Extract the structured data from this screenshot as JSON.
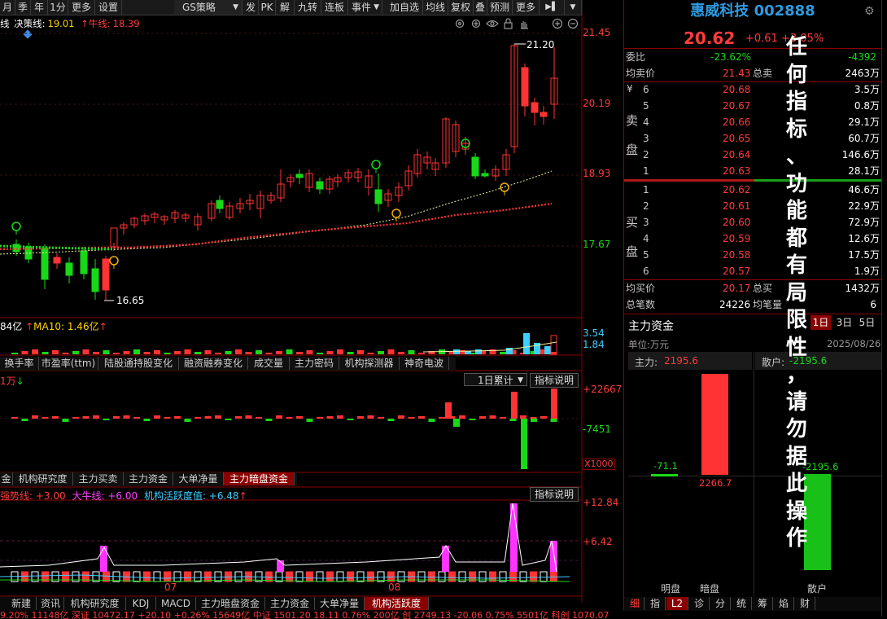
{
  "toolbar": {
    "items": [
      "月",
      "季",
      "年",
      "1分",
      "更多",
      "设置",
      "GS策略",
      "发",
      "PK",
      "解",
      "九转",
      "连板",
      "事件",
      "加自选",
      "均线",
      "复权",
      "叠",
      "预测",
      "更多"
    ],
    "strategy_dropdown_caret": "▼",
    "collapse_icon": "▶▌",
    "dropdown_caret": "▼"
  },
  "main_chart": {
    "legend": {
      "name": "线",
      "decision_label": "决策线:",
      "decision_value": "19.01",
      "bull_label": "牛线:",
      "bull_value": "18.39",
      "bull_arrow": "↑"
    },
    "price_labels": [
      "21.45",
      "20.19",
      "18.93",
      "17.67"
    ],
    "high_label": "21.20",
    "low_label": "16.65",
    "toolbar_icons": [
      "settings-icon",
      "settings-alt-icon",
      "eye-icon",
      "lock-icon",
      "hand-icon",
      "zoom-in-icon",
      "zoom-out-icon"
    ]
  },
  "volume": {
    "legend_left": "84亿",
    "ma10_label": "MA10: 1.46亿",
    "ma10_arrow": "↑",
    "labels": [
      "3.54",
      "1.84"
    ]
  },
  "tabs_1": [
    "换手率",
    "市盈率(ttm)",
    "陆股通持股变化",
    "融资融券变化",
    "成交量",
    "主力密码",
    "机构探测器",
    "神奇电波"
  ],
  "fund_flow": {
    "unit": "1万",
    "unit_arrow": "↓",
    "period_select": "1日累计",
    "explain_button": "指标说明",
    "labels": [
      "+22667",
      "-7451"
    ],
    "multiplier": "X1000"
  },
  "tabs_2": [
    "金",
    "机构研究度",
    "主力买卖",
    "主力资金",
    "大单净量",
    "主力暗盘资金"
  ],
  "indicator": {
    "legend_strong": "强势线: +3.00",
    "legend_bull": "大牛线: +6.00",
    "legend_active": "机构活跃度值: +6.48",
    "legend_active_arrow": "↑",
    "explain_button": "指标说明",
    "labels": [
      "+12.84",
      "+6.42"
    ],
    "x_labels": [
      "07",
      "08"
    ]
  },
  "tabs_bottom": [
    "新建",
    "资讯",
    "机构研究度",
    "KDJ",
    "MACD",
    "主力暗盘资金",
    "主力资金",
    "大单净量",
    "机构活跃度"
  ],
  "bottom_ticker": "9.20%   11148亿   深证   10472.17  +20.10  +0.26%   15649亿   中证   1501.20   18.11   0.76%   200亿   创   2749.13  -20.06   0.75%   5501亿   科创   1070.07",
  "stock": {
    "name": "惠威科技",
    "code": "002888",
    "price": "20.62",
    "change": "+0.61",
    "change_pct": "+3.05%"
  },
  "order_book": {
    "weibi_label": "委比",
    "weibi_value": "-23.62%",
    "weicha_value": "-4392",
    "avg_sell_label": "均卖价",
    "avg_sell_value": "21.43",
    "total_sell_label": "总卖",
    "total_sell_value": "2463万",
    "sell_side_label": [
      "卖",
      "盘"
    ],
    "buy_side_label": [
      "买",
      "盘"
    ],
    "yen": "¥",
    "sells": [
      {
        "level": "6",
        "price": "20.68",
        "vol": "3.5万"
      },
      {
        "level": "5",
        "price": "20.67",
        "vol": "0.8万"
      },
      {
        "level": "4",
        "price": "20.66",
        "vol": "29.1万"
      },
      {
        "level": "3",
        "price": "20.65",
        "vol": "60.7万"
      },
      {
        "level": "2",
        "price": "20.64",
        "vol": "146.6万"
      },
      {
        "level": "1",
        "price": "20.63",
        "vol": "28.1万"
      }
    ],
    "buys": [
      {
        "level": "1",
        "price": "20.62",
        "vol": "46.6万"
      },
      {
        "level": "2",
        "price": "20.61",
        "vol": "22.9万"
      },
      {
        "level": "3",
        "price": "20.60",
        "vol": "72.9万"
      },
      {
        "level": "4",
        "price": "20.59",
        "vol": "12.6万"
      },
      {
        "level": "5",
        "price": "20.58",
        "vol": "17.5万"
      },
      {
        "level": "6",
        "price": "20.57",
        "vol": "1.9万"
      }
    ],
    "avg_buy_label": "均买价",
    "avg_buy_value": "20.17",
    "total_buy_label": "总买",
    "total_buy_value": "1432万",
    "total_deals_label": "总笔数",
    "total_deals_value": "24226",
    "avg_deal_label": "均笔量",
    "avg_deal_value": "6"
  },
  "capital_panel": {
    "title": "主力资金",
    "day_buttons": [
      "1日",
      "3日",
      "5日"
    ],
    "unit": "单位:万元",
    "date": "2025/08/26",
    "main_label": "主力:",
    "main_value": "2195.6",
    "retail_label": "散户:",
    "retail_value": "-2195.6",
    "bar_visible_value": "-71.1",
    "bar_dark_value": "2266.7",
    "bar_retail_value": "-2195.6",
    "x_labels": [
      "明盘",
      "暗盘",
      "散户"
    ],
    "bottom_tabs": [
      "细",
      "指",
      "L2",
      "诊",
      "分",
      "统",
      "筹",
      "焰",
      "财"
    ]
  },
  "watermark": [
    "任",
    "何",
    "指",
    "标",
    "、",
    "功",
    "能",
    "都",
    "有",
    "局",
    "限",
    "性",
    "，",
    "请",
    "勿",
    "据",
    "此",
    "操",
    "作"
  ],
  "colors": {
    "up": "#ff3b3b",
    "down": "#18d818",
    "divider": "#8b0000",
    "accent_blue": "#2f7fd0"
  }
}
